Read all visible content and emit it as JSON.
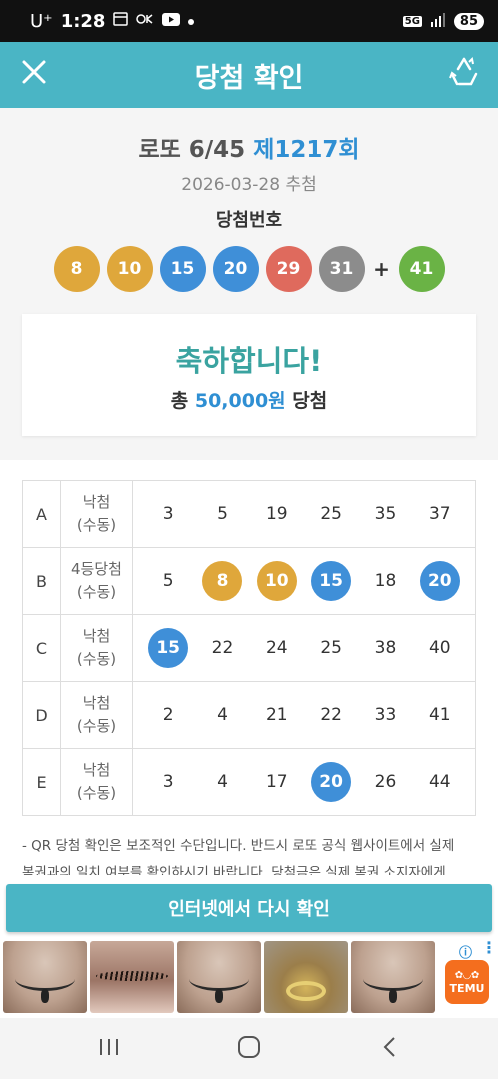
{
  "status_bar": {
    "carrier": "U⁺",
    "time": "1:28",
    "network": "5G",
    "battery": "85"
  },
  "app_bar": {
    "title": "당첨 확인"
  },
  "draw": {
    "title_prefix": "로또 6/45",
    "round": "제1217회",
    "date": "2026-03-28 추첨",
    "winning_label": "당첨번호",
    "numbers": [
      {
        "value": "8",
        "color": "#dfa73b"
      },
      {
        "value": "10",
        "color": "#dfa73b"
      },
      {
        "value": "15",
        "color": "#3f8fd8"
      },
      {
        "value": "20",
        "color": "#3f8fd8"
      },
      {
        "value": "29",
        "color": "#df6a5d"
      },
      {
        "value": "31",
        "color": "#8c8c8c"
      }
    ],
    "plus": "+",
    "bonus": {
      "value": "41",
      "color": "#6ab345"
    }
  },
  "result": {
    "congrats": "축하합니다!",
    "prize_prefix": "총",
    "prize_amount": "50,000원",
    "prize_suffix": "당첨"
  },
  "games": [
    {
      "label": "A",
      "status_line1": "낙첨",
      "status_line2": "(수동)",
      "numbers": [
        {
          "value": "3"
        },
        {
          "value": "5"
        },
        {
          "value": "19"
        },
        {
          "value": "25"
        },
        {
          "value": "35"
        },
        {
          "value": "37"
        }
      ]
    },
    {
      "label": "B",
      "status_line1": "4등당첨",
      "status_line2": "(수동)",
      "numbers": [
        {
          "value": "5"
        },
        {
          "value": "8",
          "color": "#dfa73b"
        },
        {
          "value": "10",
          "color": "#dfa73b"
        },
        {
          "value": "15",
          "color": "#3f8fd8"
        },
        {
          "value": "18"
        },
        {
          "value": "20",
          "color": "#3f8fd8"
        }
      ]
    },
    {
      "label": "C",
      "status_line1": "낙첨",
      "status_line2": "(수동)",
      "numbers": [
        {
          "value": "15",
          "color": "#3f8fd8"
        },
        {
          "value": "22"
        },
        {
          "value": "24"
        },
        {
          "value": "25"
        },
        {
          "value": "38"
        },
        {
          "value": "40"
        }
      ]
    },
    {
      "label": "D",
      "status_line1": "낙첨",
      "status_line2": "(수동)",
      "numbers": [
        {
          "value": "2"
        },
        {
          "value": "4"
        },
        {
          "value": "21"
        },
        {
          "value": "22"
        },
        {
          "value": "33"
        },
        {
          "value": "41"
        }
      ]
    },
    {
      "label": "E",
      "status_line1": "낙첨",
      "status_line2": "(수동)",
      "numbers": [
        {
          "value": "3"
        },
        {
          "value": "4"
        },
        {
          "value": "17"
        },
        {
          "value": "20",
          "color": "#3f8fd8"
        },
        {
          "value": "26"
        },
        {
          "value": "44"
        }
      ]
    }
  ],
  "notice": {
    "line1": "- QR 당첨 확인은 보조적인 수단입니다. 반드시 로또 공식 웹사이트에서 실제",
    "line2": "복권과의 일치 여부를 확인하시기 바랍니다. 당첨금은 실제 복권 소지자에게"
  },
  "recheck_button": "인터넷에서 다시 확인",
  "ad": {
    "brand": "TEMU",
    "info": "ⓘ",
    "more": "⋮"
  },
  "colors": {
    "accent": "#4ab5c5",
    "round_blue": "#2f8fd3",
    "congrats_teal": "#3aa3a0"
  },
  "icons": {
    "close": "close-icon",
    "recycle": "recycle-icon",
    "nav_recent": "recent-apps-icon",
    "nav_home": "home-icon",
    "nav_back": "back-icon"
  }
}
